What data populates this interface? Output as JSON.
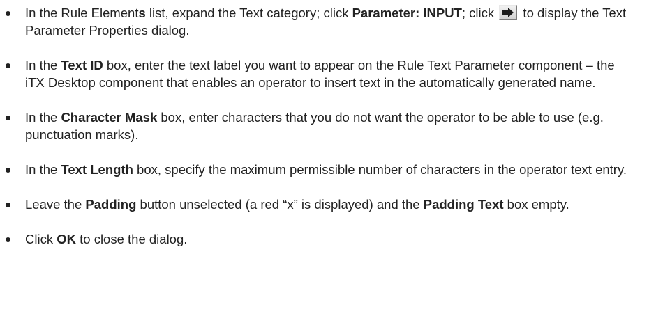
{
  "steps": [
    {
      "segments": [
        {
          "text": "In the Rule Element",
          "bold": false
        },
        {
          "text": "s",
          "bold": true
        },
        {
          "text": " list, expand the Text category; click ",
          "bold": false
        },
        {
          "text": "Parameter: INPUT",
          "bold": true
        },
        {
          "text": "; click ",
          "bold": false
        },
        {
          "icon": "right-arrow-button-icon"
        },
        {
          "text": " to display the Text Parameter Properties dialog.",
          "bold": false
        }
      ]
    },
    {
      "segments": [
        {
          "text": "In the ",
          "bold": false
        },
        {
          "text": "Text ID",
          "bold": true
        },
        {
          "text": " box, enter the text label you want to appear on the Rule Text Parameter component – the iTX Desktop component that enables an operator to insert text in the automatically generated name.",
          "bold": false
        }
      ]
    },
    {
      "segments": [
        {
          "text": "In the ",
          "bold": false
        },
        {
          "text": "Character Mask",
          "bold": true
        },
        {
          "text": " box, enter characters that you do not want the operator to be able to use (e.g. punctuation marks).",
          "bold": false
        }
      ]
    },
    {
      "segments": [
        {
          "text": "In the ",
          "bold": false
        },
        {
          "text": "Text Length",
          "bold": true
        },
        {
          "text": " box, specify the maximum permissible number of characters in the operator text entry.",
          "bold": false
        }
      ]
    },
    {
      "segments": [
        {
          "text": "Leave the ",
          "bold": false
        },
        {
          "text": "Padding",
          "bold": true
        },
        {
          "text": " button unselected (a red “x” is displayed) and the ",
          "bold": false
        },
        {
          "text": "Padding Text",
          "bold": true
        },
        {
          "text": " box empty.",
          "bold": false
        }
      ]
    },
    {
      "segments": [
        {
          "text": "Click ",
          "bold": false
        },
        {
          "text": "OK",
          "bold": true
        },
        {
          "text": " to close the dialog.",
          "bold": false
        }
      ]
    }
  ],
  "colors": {
    "text": "#222222",
    "arrow_fill": "#1a1a1a"
  }
}
